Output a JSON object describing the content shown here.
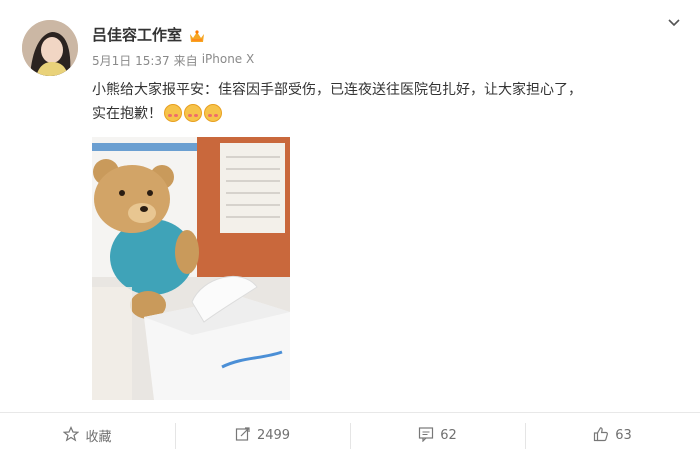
{
  "post": {
    "author": "吕佳容工作室",
    "date": "5月1日 15:37",
    "source_prefix": "来自",
    "source": "iPhone X",
    "text_line1": "小熊给大家报平安：佳容因手部受伤，已连夜送往医院包扎好，让大家担心了，",
    "text_line2": "实在抱歉！",
    "emoji_count": 3
  },
  "actions": {
    "favorite_label": "收藏",
    "repost_count": "2499",
    "comment_count": "62",
    "like_count": "63"
  },
  "icons": [
    "vip-badge-icon",
    "chevron-down-icon",
    "star-icon",
    "repost-icon",
    "comment-icon",
    "thumbs-up-icon"
  ],
  "colors": {
    "meta_text": "#8a8a8a",
    "action_text": "#707070",
    "emoji": "#f6c34a"
  }
}
